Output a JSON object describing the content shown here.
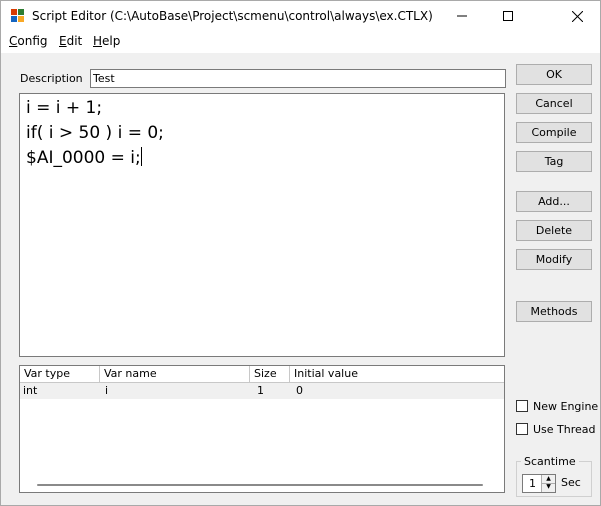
{
  "window": {
    "title": "Script Editor (C:\\AutoBase\\Project\\scmenu\\control\\always\\ex.CTLX)"
  },
  "menu": [
    {
      "accel": "C",
      "rest": "onfig"
    },
    {
      "accel": "E",
      "rest": "dit"
    },
    {
      "accel": "H",
      "rest": "elp"
    }
  ],
  "description": {
    "label": "Description",
    "value": "Test"
  },
  "script": {
    "lines": [
      "i = i + 1;",
      "if( i > 50 ) i = 0;",
      "$AI_0000 = i;"
    ]
  },
  "variables": {
    "columns": [
      "Var type",
      "Var name",
      "Size",
      "Initial value"
    ],
    "rows": [
      [
        "int",
        "i",
        "1",
        "0"
      ]
    ]
  },
  "buttons": {
    "ok": "OK",
    "cancel": "Cancel",
    "compile": "Compile",
    "tag": "Tag",
    "add": "Add...",
    "delete": "Delete",
    "modify": "Modify",
    "methods": "Methods"
  },
  "options": {
    "new_engine": {
      "label": "New Engine",
      "checked": false
    },
    "use_thread": {
      "label": "Use Thread",
      "checked": false
    }
  },
  "scantime": {
    "label": "Scantime",
    "value": "1",
    "unit": "Sec"
  },
  "colors": {
    "window_bg": "#f0f0f0",
    "button_bg": "#e1e1e1",
    "border": "#7a7a7a"
  }
}
